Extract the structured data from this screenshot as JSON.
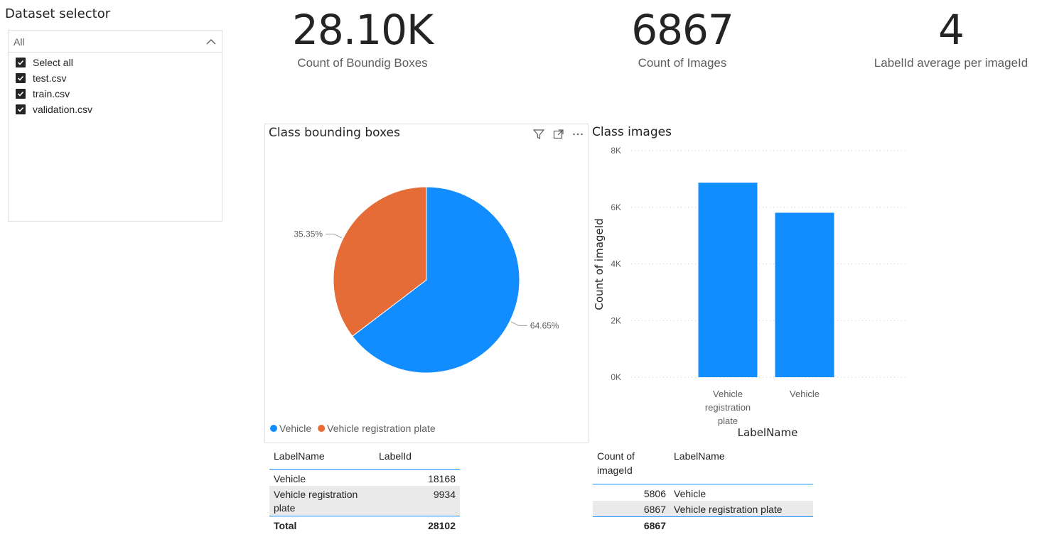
{
  "slicer": {
    "title": "Dataset selector",
    "dropdown_value": "All",
    "items": [
      {
        "label": "Select all",
        "checked": true
      },
      {
        "label": "test.csv",
        "checked": true
      },
      {
        "label": "train.csv",
        "checked": true
      },
      {
        "label": "validation.csv",
        "checked": true
      }
    ]
  },
  "kpis": [
    {
      "value": "28.10K",
      "label": "Count of Boundig Boxes"
    },
    {
      "value": "6867",
      "label": "Count of Images"
    },
    {
      "value": "4",
      "label": "LabelId average per imageId"
    }
  ],
  "colors": {
    "vehicle": "#118dff",
    "plate": "#e66c37",
    "text": "#252423",
    "subtext": "#605e5c",
    "gridline": "#c8c6c4"
  },
  "pie_visual": {
    "title": "Class bounding boxes",
    "header_icons": [
      "filter-icon",
      "focus-mode-icon",
      "more-options-icon"
    ]
  },
  "bar_visual": {
    "title": "Class images"
  },
  "chart_data": [
    {
      "type": "pie",
      "title": "Class bounding boxes",
      "labels": [
        "Vehicle",
        "Vehicle registration plate"
      ],
      "values": [
        18168,
        9934
      ],
      "percent_labels": [
        "64.65%",
        "35.35%"
      ],
      "colors": [
        "#118dff",
        "#e66c37"
      ],
      "legend": "bottom-left"
    },
    {
      "type": "bar",
      "title": "Class images",
      "categories": [
        "Vehicle registration plate",
        "Vehicle"
      ],
      "category_lines": [
        [
          "Vehicle",
          "registration",
          "plate"
        ],
        [
          "Vehicle"
        ]
      ],
      "values": [
        6867,
        5806
      ],
      "xlabel": "LabelName",
      "ylabel": "Count of imageId",
      "ylim": [
        0,
        8000
      ],
      "yticks": [
        0,
        2000,
        4000,
        6000,
        8000
      ],
      "ytick_labels": [
        "0K",
        "2K",
        "4K",
        "6K",
        "8K"
      ],
      "grid": true,
      "color": "#118dff"
    }
  ],
  "table_left": {
    "headers": [
      "LabelName",
      "LabelId"
    ],
    "rows": [
      {
        "name": "Vehicle",
        "value": "18168"
      },
      {
        "name_line1": "Vehicle registration",
        "name_line2": "plate",
        "value": "9934"
      }
    ],
    "total_label": "Total",
    "total_value": "28102"
  },
  "table_right": {
    "headers": [
      "Count of",
      "imageId",
      "LabelName"
    ],
    "rows": [
      {
        "value": "5806",
        "name": "Vehicle"
      },
      {
        "value": "6867",
        "name": "Vehicle registration plate"
      }
    ],
    "total_value": "6867"
  }
}
